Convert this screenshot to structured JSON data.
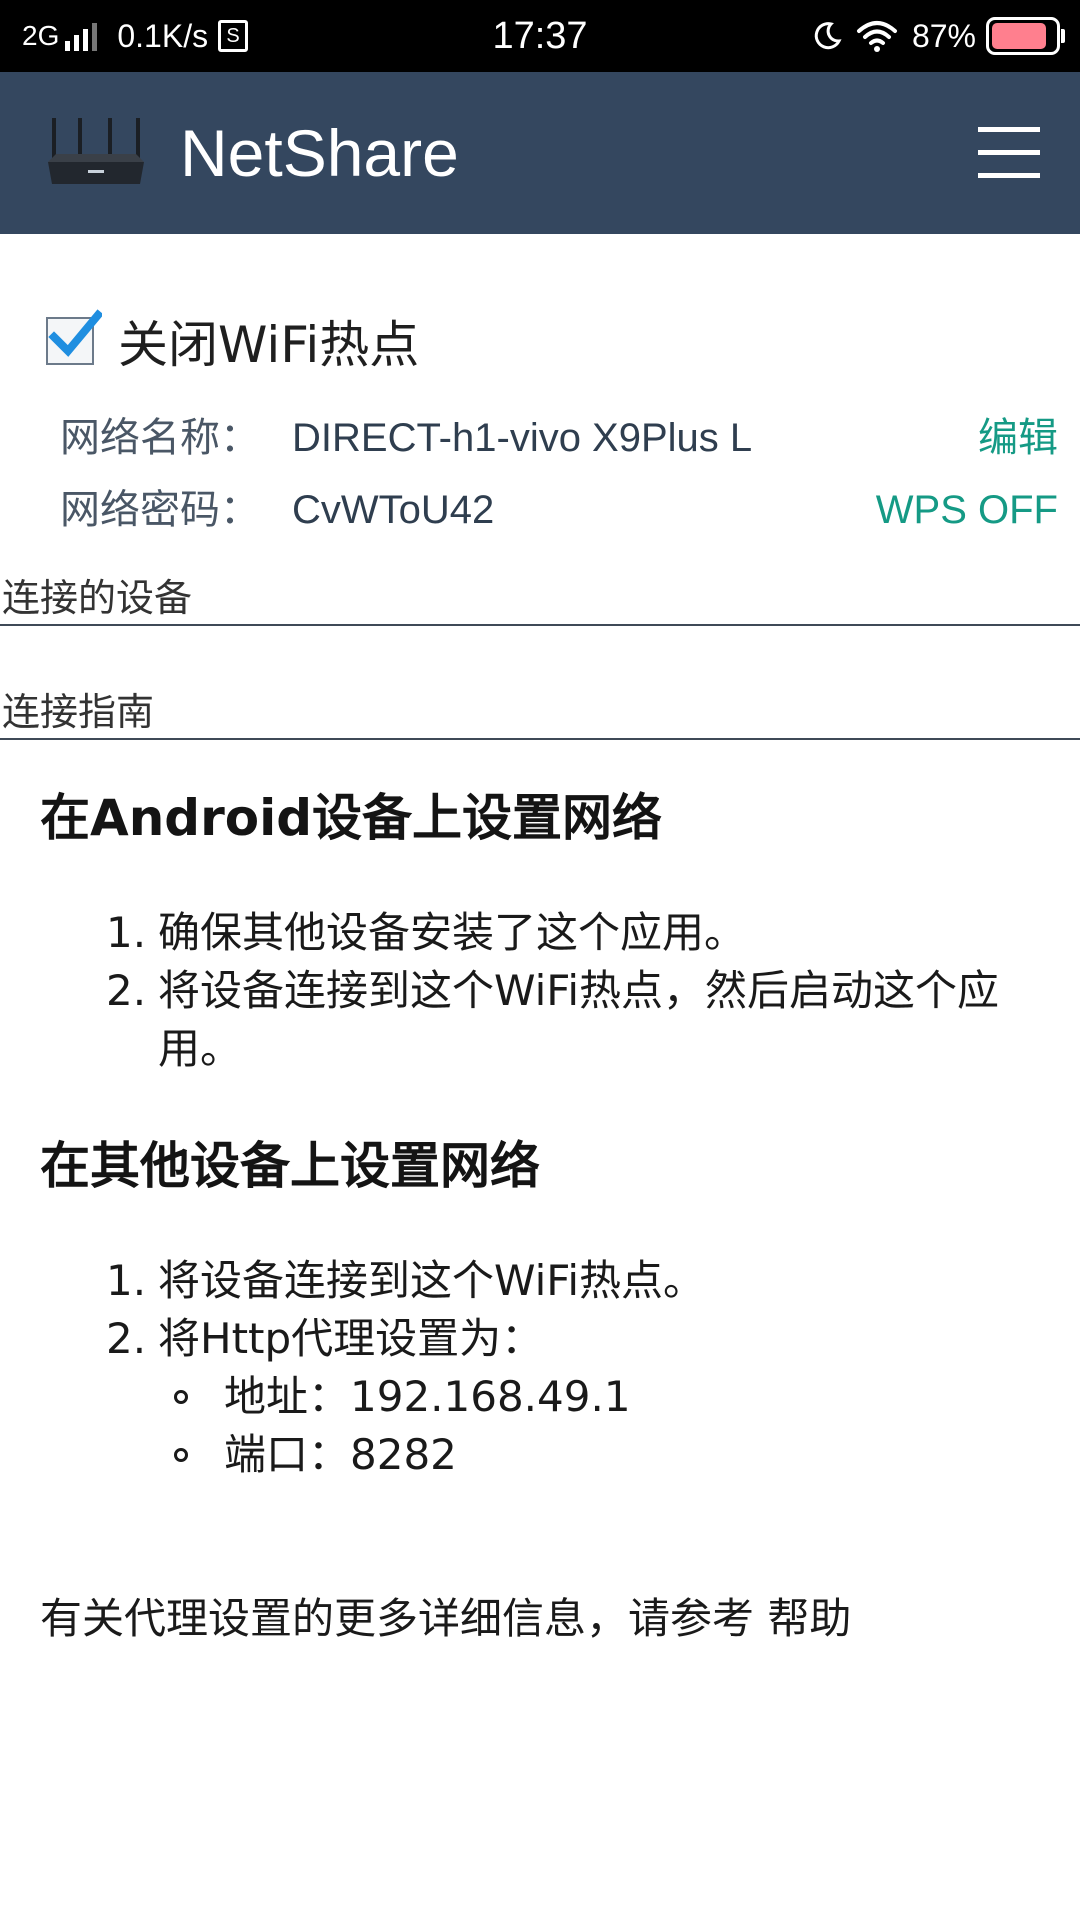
{
  "status_bar": {
    "network": "2G",
    "speed": "0.1K/s",
    "s_badge": "S",
    "time": "17:37",
    "battery": "87%",
    "battery_level": 0.87,
    "battery_color": "#ff7f8e"
  },
  "app_bar": {
    "title": "NetShare",
    "logo_icon": "router-icon",
    "menu_icon": "hamburger-menu-icon",
    "background": "#34475f"
  },
  "hotspot": {
    "checkbox_label": "关闭WiFi热点",
    "checked": true,
    "ssid_label": "网络名称：",
    "ssid_value": "DIRECT-h1-vivo X9Plus L",
    "edit_action": "编辑",
    "password_label": "网络密码：",
    "password_value": "CvWToU42",
    "wps_action": "WPS OFF",
    "accent_color": "#159a85"
  },
  "sections": {
    "connected_devices": "连接的设备",
    "connection_guide": "连接指南"
  },
  "guide": {
    "android_title": "在Android设备上设置网络",
    "android_steps": [
      {
        "num": "1.",
        "text": "确保其他设备安装了这个应用。"
      },
      {
        "num": "2.",
        "text": "将设备连接到这个WiFi热点，然后启动这个应用。"
      }
    ],
    "other_title": "在其他设备上设置网络",
    "other_steps": [
      {
        "num": "1.",
        "text": "将设备连接到这个WiFi热点。"
      },
      {
        "num": "2.",
        "text": "将Http代理设置为："
      }
    ],
    "proxy_address": "地址：192.168.49.1",
    "proxy_port": "端口：8282",
    "footer_text": "有关代理设置的更多详细信息，请参考",
    "help_link": "帮助"
  }
}
